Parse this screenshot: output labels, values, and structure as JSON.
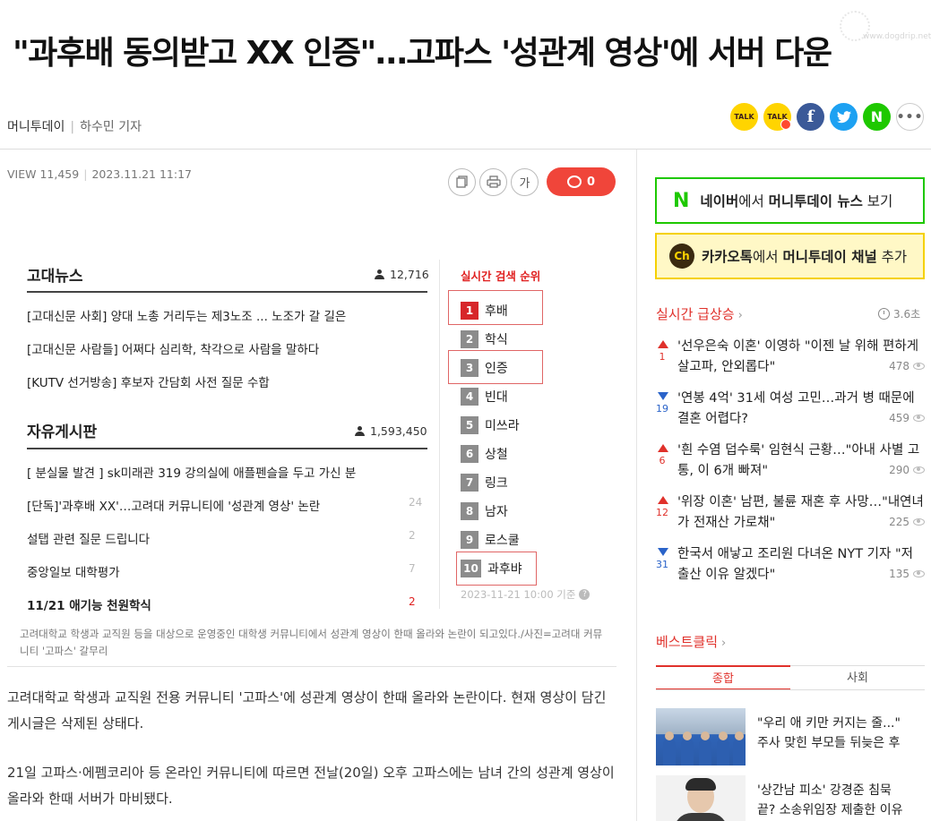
{
  "article": {
    "headline": "\"과후배 동의받고 XX 인증\"…고파스 '성관계 영상'에 서버 다운",
    "source": "머니투데이",
    "reporter": "하수민 기자",
    "views_label": "VIEW 11,459",
    "datetime": "2023.11.21 11:17",
    "comment_count": "0",
    "font_size_label": "가",
    "caption": "고려대학교 학생과 교직원 등을 대상으로 운영중인 대학생 커뮤니티에서 성관계 영상이 한때 올라와 논란이 되고있다./사진=고려대 커뮤니티 '고파스' 갈무리",
    "paragraphs": [
      "고려대학교 학생과 교직원 전용 커뮤니티 '고파스'에 성관계 영상이 한때 올라와 논란이다. 현재 영상이 담긴 게시글은 삭제된 상태다.",
      "21일 고파스·에펨코리아 등 온라인 커뮤니티에 따르면 전날(20일) 오후 고파스에는 남녀 간의 성관계 영상이 올라와 한때 서버가 마비됐다."
    ]
  },
  "watermark": {
    "text": "www.dogdrip.net"
  },
  "share": {
    "buttons": [
      {
        "name": "kakaotalk-share-icon",
        "label": "TALK"
      },
      {
        "name": "kakaotalk-channel-share-icon",
        "label": "TALK"
      },
      {
        "name": "facebook-share-icon",
        "label": "f"
      },
      {
        "name": "twitter-share-icon",
        "label": "🐦"
      },
      {
        "name": "naver-share-icon",
        "label": "N"
      },
      {
        "name": "more-share-icon",
        "label": "•••"
      }
    ]
  },
  "embedded": {
    "news": {
      "title": "고대뉴스",
      "count": "12,716",
      "posts": [
        "[고대신문 사회] 양대 노총 거리두는 제3노조 ... 노조가 갈 길은",
        "[고대신문 사람들] 어쩌다 심리학, 착각으로 사람을 말하다",
        "[KUTV 선거방송] 후보자 간담회 사전 질문 수합"
      ]
    },
    "board": {
      "title": "자유게시판",
      "count": "1,593,450",
      "posts": [
        {
          "text": "[ 분실물 발견 ] sk미래관 319 강의실에 애플펜슬을 두고 가신 분",
          "count": ""
        },
        {
          "text": "[단독]'과후배 XX'…고려대 커뮤니티에 '성관계 영상' 논란",
          "count": "24"
        },
        {
          "text": "설탭 관련 질문 드립니다",
          "count": "2"
        },
        {
          "text": "중앙일보 대학평가",
          "count": "7"
        },
        {
          "text": "11/21 애기능 천원학식",
          "count": "2"
        }
      ]
    },
    "ranking": {
      "title": "실시간 검색 순위",
      "items": [
        {
          "num": "1",
          "word": "후배"
        },
        {
          "num": "2",
          "word": "학식"
        },
        {
          "num": "3",
          "word": "인증"
        },
        {
          "num": "4",
          "word": "빈대"
        },
        {
          "num": "5",
          "word": "미쓰라"
        },
        {
          "num": "6",
          "word": "상철"
        },
        {
          "num": "7",
          "word": "링크"
        },
        {
          "num": "8",
          "word": "남자"
        },
        {
          "num": "9",
          "word": "로스쿨"
        },
        {
          "num": "10",
          "word": "과후뱌"
        }
      ],
      "timestamp": "2023-11-21 10:00 기준",
      "help_label": "?"
    }
  },
  "sidebar": {
    "naver_banner": {
      "logo": "N",
      "pre": "네이버",
      "mid": "에서 ",
      "brand": "머니투데이 뉴스",
      "post": " 보기"
    },
    "kakao_banner": {
      "logo": "Ch",
      "pre": "카카오톡",
      "mid": "에서 ",
      "brand": "머니투데이 채널",
      "post": " 추가"
    },
    "trending": {
      "title": "실시간 급상승",
      "updated": "3.6초",
      "items": [
        {
          "dir": "up",
          "change": "1",
          "text": "'선우은숙 이혼' 이영하 \"이젠 날 위해 편하게 살고파, 안외롭다\"",
          "views": "478"
        },
        {
          "dir": "down",
          "change": "19",
          "text": "'연봉 4억' 31세 여성 고민…과거 병 때문에 결혼 어렵다?",
          "views": "459"
        },
        {
          "dir": "up",
          "change": "6",
          "text": "'흰 수염 덥수룩' 임현식 근황…\"아내 사별 고통, 이 6개 빠져\"",
          "views": "290"
        },
        {
          "dir": "up",
          "change": "12",
          "text": "'위장 이혼' 남편, 불륜 재혼 후 사망…\"내연녀가 전재산 가로채\"",
          "views": "225"
        },
        {
          "dir": "down",
          "change": "31",
          "text": "한국서 애낳고 조리원 다녀온 NYT 기자 \"저출산 이유 알겠다\"",
          "views": "135"
        }
      ]
    },
    "best": {
      "title": "베스트클릭",
      "tabs": [
        "종합",
        "사회"
      ],
      "items": [
        {
          "line1": "\"우리 애 키만 커지는 줄...\"",
          "line2": "주사 맞힌 부모들 뒤늦은 후"
        },
        {
          "line1": "'상간남 피소' 강경준 침묵",
          "line2": "끝? 소송위임장 제출한 이유"
        }
      ]
    }
  },
  "colors": {
    "accent_red": "#e0312b",
    "naver_green": "#1ec800",
    "kakao_yellow": "#ffd400",
    "comment_red": "#f0453a"
  }
}
